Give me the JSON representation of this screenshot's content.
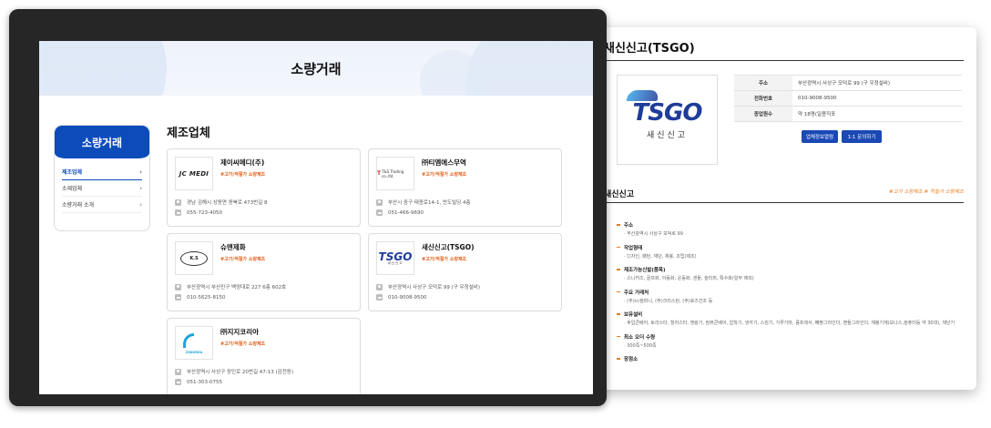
{
  "detail": {
    "title": "새신신고(TSGO)",
    "logo_text": "TSGO",
    "logo_sub": "새신신고",
    "info": [
      {
        "key": "주소",
        "value": "부산광역시 사상구 모덕로 99 (구 우정설비)"
      },
      {
        "key": "전화번호",
        "value": "010-9008-9500"
      },
      {
        "key": "종업원수",
        "value": "약 18명(일용직포"
      }
    ],
    "btn_company": "업체정보열람",
    "btn_inquiry": "1:1 문의하기",
    "section_title": "새신신고",
    "section_tag": "#고가 소량제조 # 적질가 소량제조",
    "specs": [
      {
        "key": "주소",
        "value": "· 부산광역시 사상구 모덕로 99"
      },
      {
        "key": "작업형태",
        "value": "· 디자인, 패턴, 재단, 재봉, 조립(제조)"
      },
      {
        "key": "제조가능신발(품목)",
        "value": "· 스니커즈, 골프화, 아동화, 운동화, 샌들, 슬리퍼, 특수화(일부 제외)"
      },
      {
        "key": "주요 거래처",
        "value": "· (주)cc컴퍼니, (주)크리스탄, (주)로즈간조 등"
      },
      {
        "key": "보유설비",
        "value": "· 후입콘베어, 토라스타, 힐러스타, 쟁링기, 컴퓨콘베어, 압착기, 냉각기, 스킹기, 가루가마, 콤프레서, 빼짱그라인더, 맨들그라인더, 재봉기계(보나스,컴퓨터등 약 30대), 재단기"
      },
      {
        "key": "최소 오더 수량",
        "value": "· 300족~500족"
      },
      {
        "key": "장점소",
        "value": ""
      }
    ]
  },
  "site": {
    "hero_title": "소량거래",
    "side_title": "소량거래",
    "side_items": [
      {
        "label": "제조업체",
        "chev": "›"
      },
      {
        "label": "소재업체",
        "chev": "›"
      },
      {
        "label": "소량거래 소개",
        "chev": "›"
      }
    ],
    "list_title": "제조업체",
    "cards": [
      {
        "name": "제이씨메디(주)",
        "tag": "#고가/적절가 소량제조",
        "logo": "JC MEDI",
        "addr": "경남 김해시 상동면 동북로 473번길 8",
        "tel": "055-723-4050"
      },
      {
        "name": "㈜티엠에스무역",
        "tag": "#고가/적절가 소량제조",
        "logo": "T&S Trading co.,ltd",
        "addr": "부산시 중구 태종로14-1, 반도빌딩 4층",
        "tel": "051-466-9690"
      },
      {
        "name": "슈맨제화",
        "tag": "#고가/적절가 소량제조",
        "logo": "K.S",
        "addr": "부산광역시 부산진구 백양대로 227 6층 602호",
        "tel": "010-5625-8150"
      },
      {
        "name": "새신신고(TSGO)",
        "tag": "#고가/적절가 소량제조",
        "logo": "TSGO",
        "logo_sub": "새신신고",
        "addr": "부산광역시 사상구 모덕로 99 (구 우정설비)",
        "tel": "010-9008-9500"
      },
      {
        "name": "㈜지지코리아",
        "tag": "#고가/적절가 소량제조",
        "logo": "ZZKOREA",
        "addr": "부산광역시 사상구 장인로 20번길 47-13 (감전동)",
        "tel": "051-303-0755"
      }
    ]
  },
  "colors": {
    "brand_blue": "#0c4cba",
    "accent_orange": "#e0611b",
    "frame": "#262626"
  }
}
